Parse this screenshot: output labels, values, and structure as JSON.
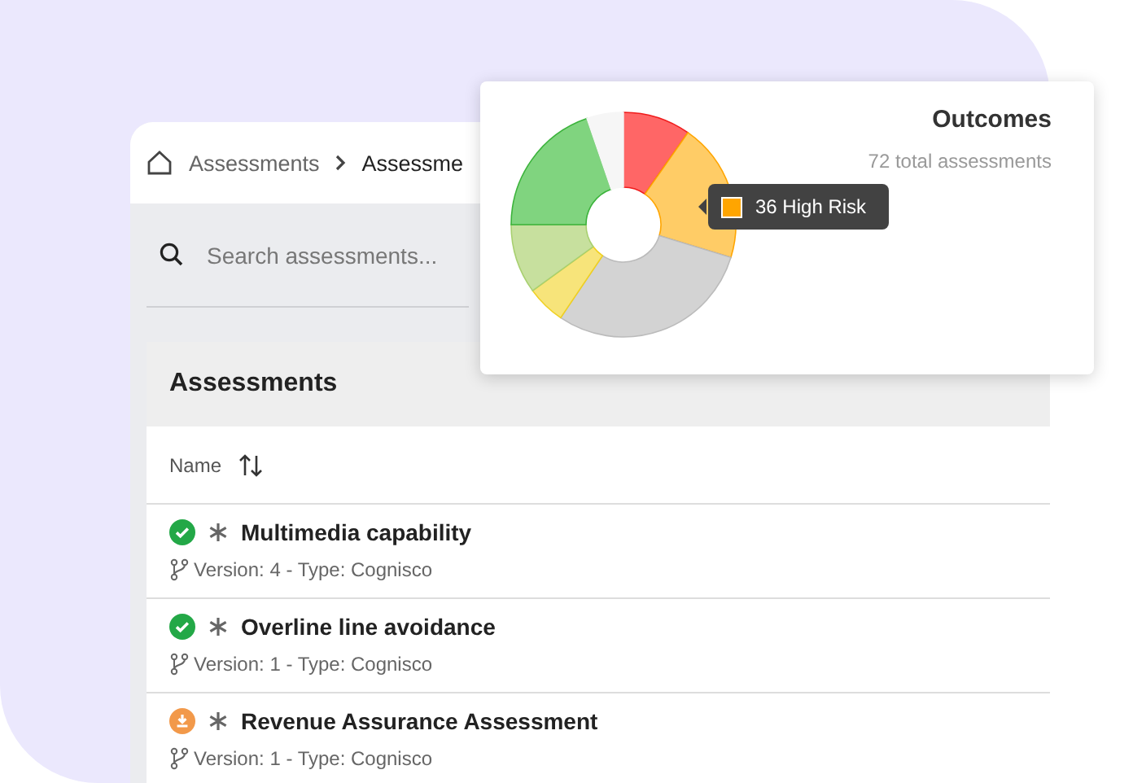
{
  "breadcrumb": {
    "items": [
      "Assessments",
      "Assessme"
    ]
  },
  "search": {
    "placeholder": "Search assessments..."
  },
  "table": {
    "title": "Assessments",
    "columns": [
      {
        "label": "Name"
      }
    ],
    "rows": [
      {
        "name": "Multimedia capability",
        "meta": "Version: 4 - Type: Cognisco",
        "kind": "complete"
      },
      {
        "name": "Overline line avoidance",
        "meta": "Version: 1 - Type: Cognisco",
        "kind": "complete"
      },
      {
        "name": "Revenue Assurance Assessment",
        "meta": "Version: 1 - Type: Cognisco",
        "kind": "pending"
      }
    ]
  },
  "outcomes": {
    "title": "Outcomes",
    "subtitle": "72 total assessments",
    "tooltip": {
      "label": "36 High Risk",
      "color": "#ffa500"
    }
  }
}
